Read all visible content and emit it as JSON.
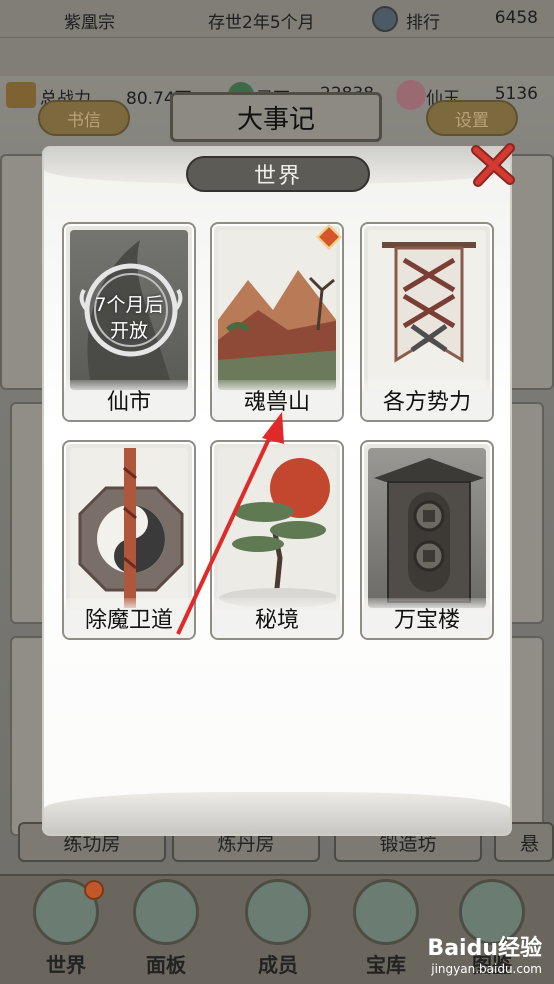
{
  "status": {
    "sect_name": "紫凰宗",
    "era": "存世2年5个月",
    "rank_label": "排行",
    "rank_value": "6458",
    "power_label": "总战力",
    "power_value": "80.74万",
    "stone_label": "灵石",
    "stone_value": "22838",
    "jade_label": "仙玉",
    "jade_value": "5136"
  },
  "header": {
    "letter_button": "书信",
    "title": "大事记",
    "settings_button": "设置"
  },
  "background_buildings": [
    "练功房",
    "炼丹房",
    "锻造坊",
    "悬"
  ],
  "modal": {
    "title": "世界",
    "cards": [
      {
        "label": "仙市",
        "locked_text_line1": "7个月后",
        "locked_text_line2": "开放"
      },
      {
        "label": "魂兽山",
        "has_badge": true
      },
      {
        "label": "各方势力"
      },
      {
        "label": "除魔卫道"
      },
      {
        "label": "秘境"
      },
      {
        "label": "万宝楼"
      }
    ]
  },
  "nav": {
    "items": [
      "世界",
      "面板",
      "成员",
      "宝库",
      "图鉴"
    ]
  },
  "watermark": {
    "brand": "Baidu经验",
    "url": "jingyan.baidu.com"
  },
  "colors": {
    "modal_title_bg": "#5d5b55",
    "close_red": "#c0302a",
    "badge": "#d4562a",
    "arrow": "#e02a2a"
  }
}
